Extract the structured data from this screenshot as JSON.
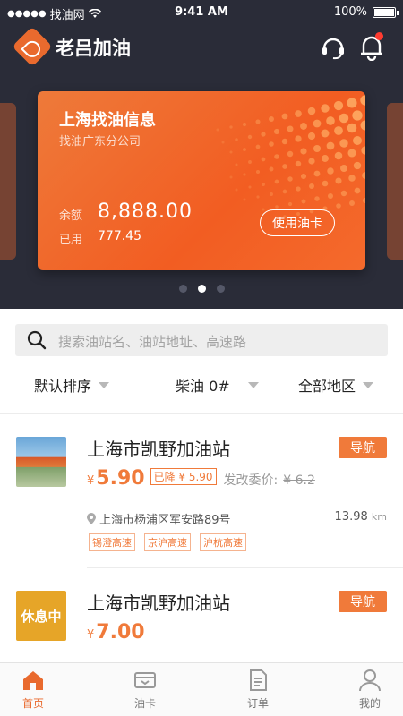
{
  "status_bar": {
    "carrier": "找油网",
    "time": "9:41 AM",
    "battery": "100%"
  },
  "app": {
    "title": "老吕加油"
  },
  "card": {
    "company": "上海找油信息",
    "branch": "找油广东分公司",
    "balance_label": "余额",
    "balance": "8,888.00",
    "used_label": "已用",
    "used": "777.45",
    "use_button": "使用油卡"
  },
  "carousel": {
    "page_count": 3,
    "active_index": 1
  },
  "search": {
    "placeholder": "搜索油站名、油站地址、高速路"
  },
  "filters": {
    "sort": "默认排序",
    "fuel": "柴油 0#",
    "region": "全部地区"
  },
  "stations": [
    {
      "name": "上海市凯野加油站",
      "nav_label": "导航",
      "currency": "¥",
      "price": "5.90",
      "reduced": "已降 ¥ 5.90",
      "ndrc_label": "发改委价:",
      "ndrc_price": "¥ 6.2",
      "address": "上海市杨浦区军安路89号",
      "distance": "13.98",
      "distance_unit": "km",
      "tags": [
        "锡澄高速",
        "京沪高速",
        "沪杭高速"
      ]
    },
    {
      "name": "上海市凯野加油站",
      "nav_label": "导航",
      "currency": "¥",
      "price": "7.00",
      "status_badge": "休息中"
    }
  ],
  "tabbar": {
    "items": [
      {
        "label": "首页",
        "icon": "home-icon",
        "active": true
      },
      {
        "label": "油卡",
        "icon": "card-icon",
        "active": false
      },
      {
        "label": "订单",
        "icon": "order-icon",
        "active": false
      },
      {
        "label": "我的",
        "icon": "user-icon",
        "active": false
      }
    ]
  },
  "colors": {
    "accent": "#f07a3a",
    "header_bg": "#2a2c38",
    "notification_dot": "#ff3b30"
  }
}
